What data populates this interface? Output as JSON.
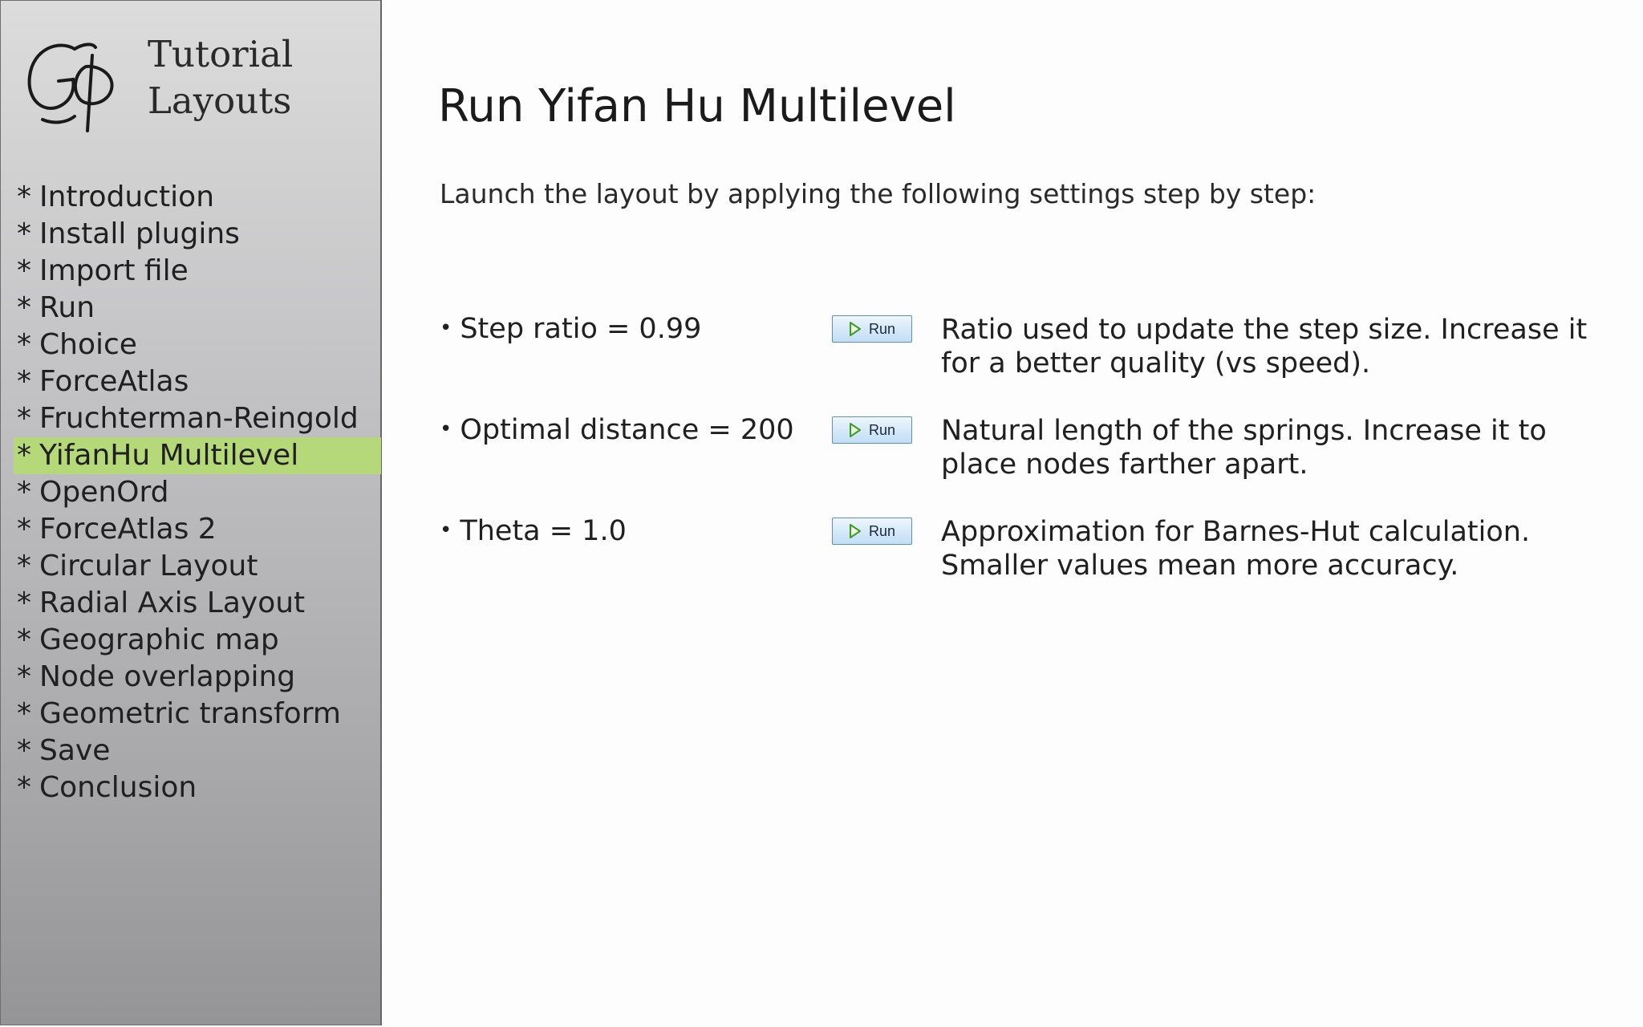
{
  "sidebar": {
    "brand_line1": "Tutorial",
    "brand_line2": "Layouts",
    "logo_icon": "gephi-logo-icon",
    "items": [
      {
        "label": "Introduction"
      },
      {
        "label": "Install plugins"
      },
      {
        "label": "Import file"
      },
      {
        "label": "Run"
      },
      {
        "label": "Choice"
      },
      {
        "label": "ForceAtlas"
      },
      {
        "label": "Fruchterman-Reingold"
      },
      {
        "label": "YifanHu Multilevel",
        "active": true
      },
      {
        "label": "OpenOrd"
      },
      {
        "label": "ForceAtlas 2"
      },
      {
        "label": "Circular Layout"
      },
      {
        "label": "Radial Axis Layout"
      },
      {
        "label": "Geographic map"
      },
      {
        "label": "Node overlapping"
      },
      {
        "label": "Geometric transform"
      },
      {
        "label": "Save"
      },
      {
        "label": "Conclusion"
      }
    ],
    "bullet": "*",
    "active_color": "#b5d978"
  },
  "main": {
    "title": "Run Yifan Hu Multilevel",
    "intro": "Launch the layout by applying the following settings step by step:",
    "settings": [
      {
        "label": "Step ratio = 0.99",
        "button": "Run",
        "description": "Ratio used to update the step size. Increase it for a better quality (vs speed)."
      },
      {
        "label": "Optimal distance = 200",
        "button": "Run",
        "description": "Natural length of the springs. Increase it to place nodes farther apart."
      },
      {
        "label": "Theta = 1.0",
        "button": "Run",
        "description": "Approximation for Barnes-Hut calculation. Smaller values mean more accuracy."
      }
    ]
  }
}
